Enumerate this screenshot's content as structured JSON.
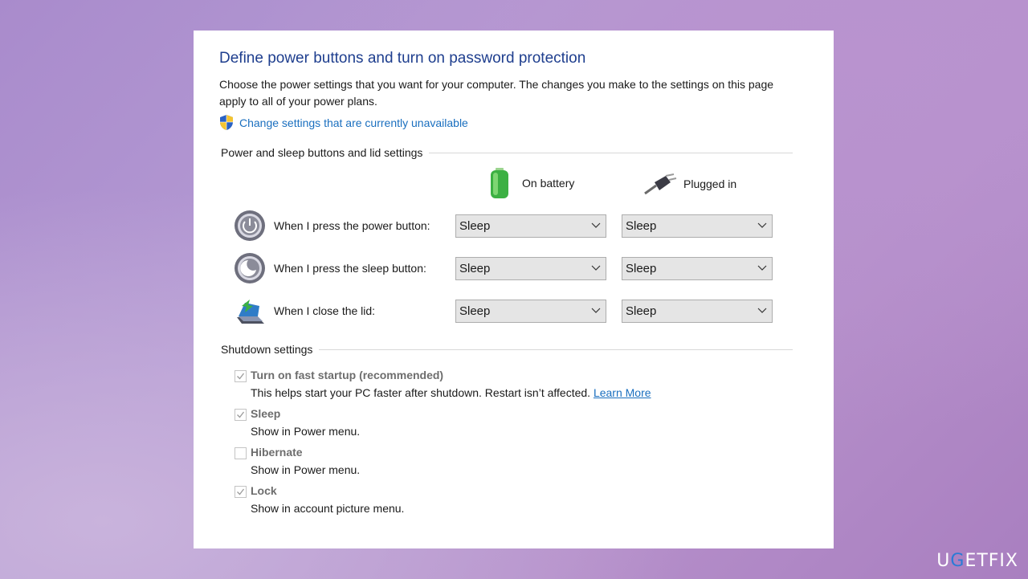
{
  "header": {
    "title": "Define power buttons and turn on password protection",
    "description": "Choose the power settings that you want for your computer. The changes you make to the settings on this page apply to all of your power plans.",
    "change_link": "Change settings that are currently unavailable"
  },
  "power_group": {
    "title": "Power and sleep buttons and lid settings",
    "col_battery": "On battery",
    "col_plugged": "Plugged in",
    "rows": [
      {
        "label": "When I press the power button:",
        "battery": "Sleep",
        "plugged": "Sleep",
        "icon": "power-button-icon"
      },
      {
        "label": "When I press the sleep button:",
        "battery": "Sleep",
        "plugged": "Sleep",
        "icon": "sleep-button-icon"
      },
      {
        "label": "When I close the lid:",
        "battery": "Sleep",
        "plugged": "Sleep",
        "icon": "laptop-lid-icon"
      }
    ]
  },
  "shutdown_group": {
    "title": "Shutdown settings",
    "options": [
      {
        "name": "Turn on fast startup (recommended)",
        "desc": "This helps start your PC faster after shutdown. Restart isn’t affected.",
        "link": "Learn More",
        "checked": true
      },
      {
        "name": "Sleep",
        "desc": "Show in Power menu.",
        "checked": true
      },
      {
        "name": "Hibernate",
        "desc": "Show in Power menu.",
        "checked": false
      },
      {
        "name": "Lock",
        "desc": "Show in account picture menu.",
        "checked": true
      }
    ]
  },
  "watermark": {
    "part1": "U",
    "part2": "G",
    "part3": "ETFIX"
  },
  "colors": {
    "title": "#1e3e8e",
    "link": "#1a6fbf",
    "battery": "#3cb043"
  }
}
